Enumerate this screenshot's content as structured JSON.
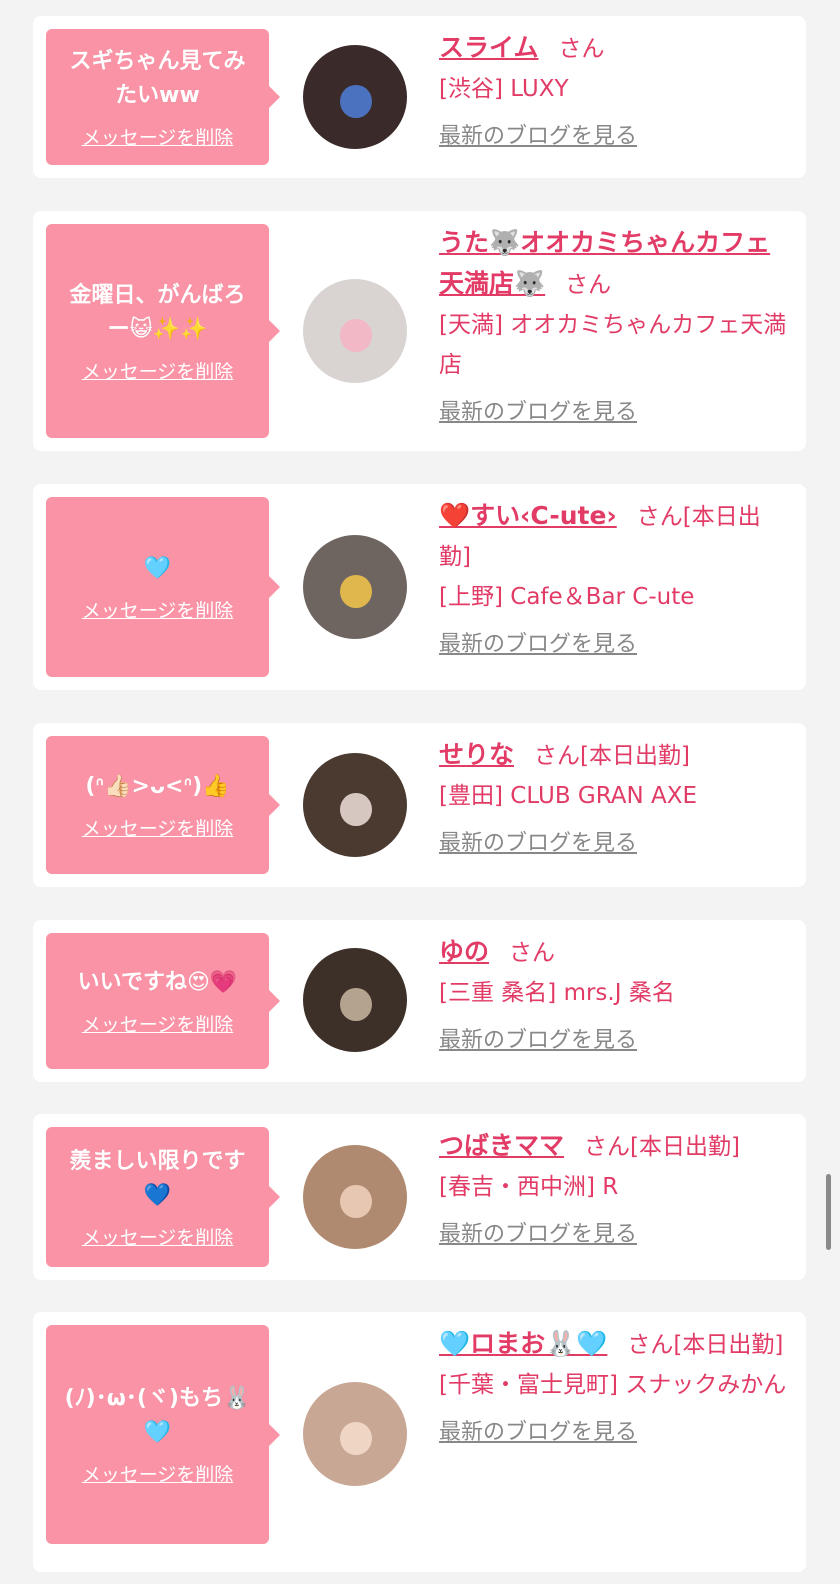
{
  "colors": {
    "background": "#f3f3f3",
    "bubble": "#fa93a6",
    "accent": "#e13b66",
    "link_gray": "#888888"
  },
  "common": {
    "delete_label": "メッセージを削除",
    "blog_label": "最新のブログを見る"
  },
  "cards": [
    {
      "message": "スギちゃん見てみ\nたいww",
      "name": "スライム",
      "honorific": "さん",
      "shop": "[渋谷] LUXY",
      "avatar": {
        "bg": "#3b2a2a",
        "face": "#4f7fd8"
      }
    },
    {
      "message": "金曜日、がんばろ\nー😺✨✨",
      "name": "うた🐺オオカミちゃんカフェ天満店🐺",
      "honorific": "さん",
      "shop": "[天満] オオカミちゃんカフェ天満店",
      "avatar": {
        "bg": "#d9d4d2",
        "face": "#f6b3c4"
      }
    },
    {
      "message": "🩵",
      "name": "❤️すい‹C-ute›",
      "honorific": "さん[本日出勤]",
      "shop": "[上野] Cafe＆Bar C-ute",
      "avatar": {
        "bg": "#6e6560",
        "face": "#f3c54a"
      }
    },
    {
      "message": "(ᐢ👍🏻>ᴗ<ᐢ)👍",
      "name": "せりな",
      "honorific": "さん[本日出勤]",
      "shop": "[豊田] CLUB GRAN AXE",
      "avatar": {
        "bg": "#4a3a30",
        "face": "#efe0da"
      }
    },
    {
      "message": "いいですね😍💗",
      "name": "ゆの",
      "honorific": "さん",
      "shop": "[三重 桑名] mrs.J 桑名",
      "avatar": {
        "bg": "#3d3029",
        "face": "#c9b7a0"
      }
    },
    {
      "message": "羨ましい限りです\n💙",
      "name": "つばきママ",
      "honorific": "さん[本日出勤]",
      "shop": "[春吉・西中洲] R",
      "avatar": {
        "bg": "#b08a70",
        "face": "#f1d1bd"
      }
    },
    {
      "message": "(ﾉ)･ω･(ヾ)もち🐰\n🩵",
      "name": "🩵ロまお🐰🩵",
      "honorific": "さん[本日出勤]",
      "shop": "[千葉・富士見町] スナックみかん",
      "avatar": {
        "bg": "#c9a795",
        "face": "#f4ddcc"
      }
    }
  ]
}
